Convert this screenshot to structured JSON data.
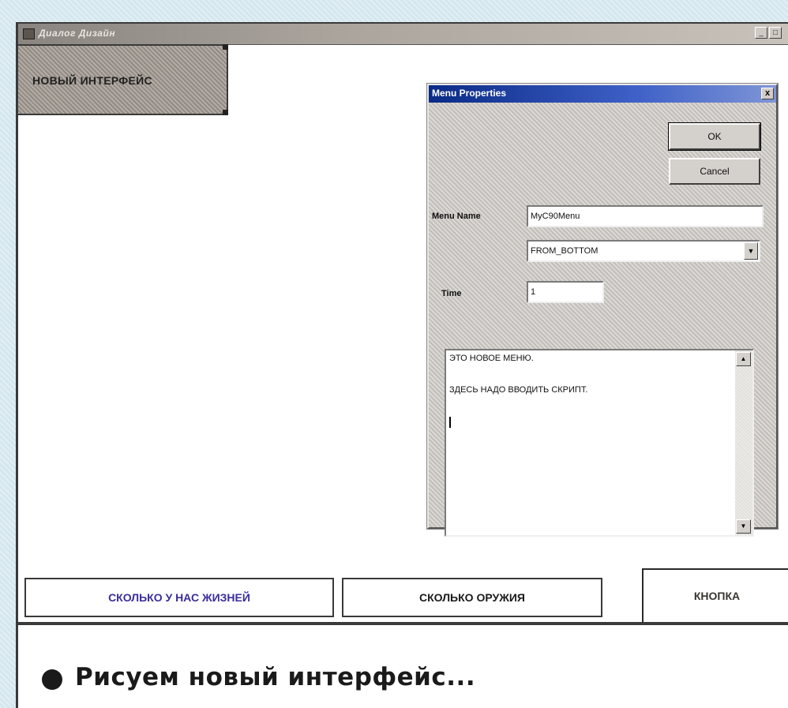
{
  "window": {
    "title": "Диалог Дизайн"
  },
  "top_left_panel": {
    "label": "НОВЫЙ ИНТЕРФЕЙС"
  },
  "dialog": {
    "title": "Menu Properties",
    "close": "x",
    "ok": "OK",
    "cancel": "Cancel",
    "menu_name_label": "Menu Name",
    "menu_name_value": "MyC90Menu",
    "direction_value": "FROM_BOTTOM",
    "time_label": "Time",
    "time_value": "1",
    "script_lines": [
      "ЭТО НОВОЕ МЕНЮ.",
      "ЗДЕСЬ НАДО ВВОДИТЬ СКРИПТ."
    ]
  },
  "bottom_buttons": {
    "lives": "СКОЛЬКО У НАС ЖИЗНЕЙ",
    "weapons": "СКОЛЬКО ОРУЖИЯ",
    "button": "КНОПКА"
  },
  "caption": {
    "text": "Рисуем новый интерфейс..."
  },
  "colors": {
    "lives_text": "#3a2d9a",
    "panel": "#a29a92",
    "dialog_title": "#0a2a86"
  }
}
